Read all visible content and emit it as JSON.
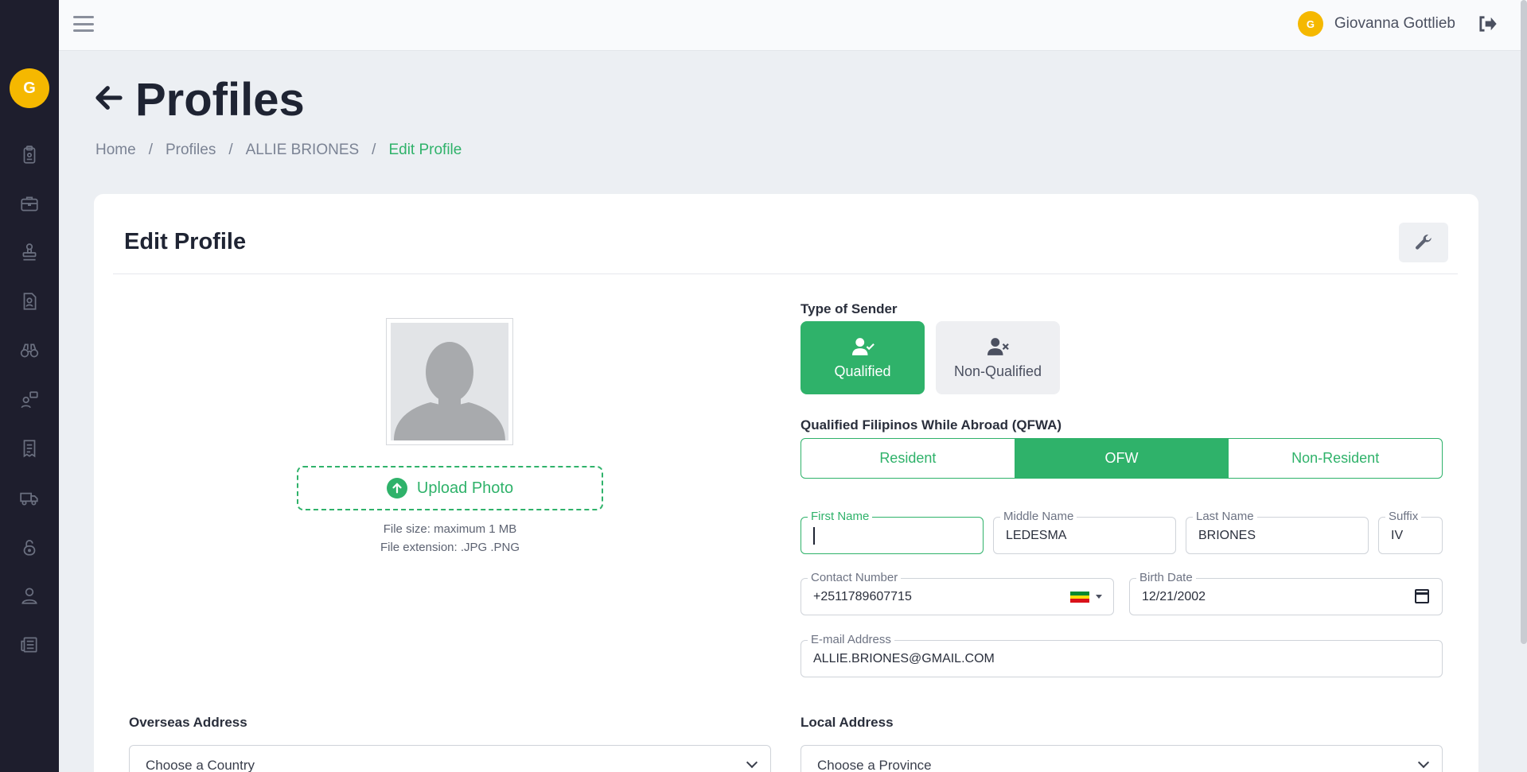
{
  "sidebar": {
    "avatar_letter": "G",
    "items": [
      "clipboard-icon",
      "briefcase-icon",
      "stamp-icon",
      "contact-file-icon",
      "binoculars-icon",
      "user-chat-icon",
      "receipt-icon",
      "truck-icon",
      "lock-icon",
      "user-icon",
      "newspaper-icon"
    ]
  },
  "topbar": {
    "user_initial": "G",
    "user_name": "Giovanna Gottlieb"
  },
  "header": {
    "title": "Profiles",
    "breadcrumb": [
      "Home",
      "Profiles",
      "ALLIE BRIONES",
      "Edit Profile"
    ],
    "separator": "/"
  },
  "card": {
    "title": "Edit Profile"
  },
  "photo": {
    "upload_label": "Upload Photo",
    "file_size_note": "File size: maximum 1 MB",
    "file_ext_note": "File extension: .JPG .PNG"
  },
  "sender": {
    "label": "Type of Sender",
    "options": [
      "Qualified",
      "Non-Qualified"
    ],
    "selected": "Qualified"
  },
  "qfwa": {
    "label": "Qualified Filipinos While Abroad (QFWA)",
    "options": [
      "Resident",
      "OFW",
      "Non-Resident"
    ],
    "selected": "OFW"
  },
  "fields": {
    "first_name": {
      "label": "First Name",
      "value": ""
    },
    "middle_name": {
      "label": "Middle Name",
      "value": "LEDESMA"
    },
    "last_name": {
      "label": "Last Name",
      "value": "BRIONES"
    },
    "suffix": {
      "label": "Suffix",
      "value": "IV"
    },
    "contact": {
      "label": "Contact Number",
      "value": "+2511789607715"
    },
    "birth_date": {
      "label": "Birth Date",
      "value": "12/21/2002"
    },
    "email": {
      "label": "E-mail Address",
      "value": "ALLIE.BRIONES@GMAIL.COM"
    }
  },
  "overseas": {
    "label": "Overseas Address",
    "placeholder": "Choose a Country"
  },
  "local": {
    "label": "Local Address",
    "placeholder": "Choose a Province"
  },
  "colors": {
    "accent": "#2fb26a",
    "sidebar_bg": "#1e1e2d",
    "avatar": "#f5b800"
  }
}
